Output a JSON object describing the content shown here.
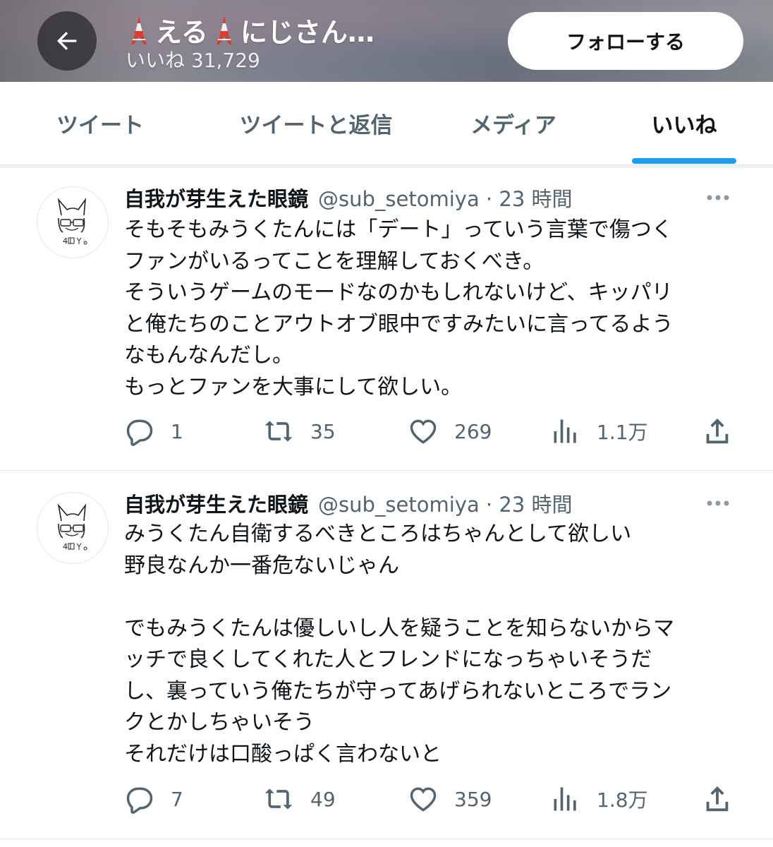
{
  "header": {
    "display_name": "える🗼にじさん…",
    "name_part1": "える",
    "name_part2": "にじさん…",
    "likes_label": "いいね 31,729",
    "follow_label": "フォローする"
  },
  "tabs": [
    {
      "label": "ツイート",
      "active": false
    },
    {
      "label": "ツイートと返信",
      "active": false
    },
    {
      "label": "メディア",
      "active": false
    },
    {
      "label": "いいね",
      "active": true
    }
  ],
  "colors": {
    "accent": "#1d9bf0",
    "text_primary": "#0f1419",
    "text_secondary": "#536471"
  },
  "tweets": [
    {
      "author": "自我が芽生えた眼鏡",
      "handle_time": "@sub_setomiya · 23 時間",
      "lines": [
        "そもそもみうくたんには「デート」っていう言葉で傷つく",
        "ファンがいるってことを理解しておくべき。",
        "そういうゲームのモードなのかもしれないけど、キッパリ",
        "と俺たちのことアウトオブ眼中ですみたいに言ってるよう",
        "なもんなんだし。",
        "もっとファンを大事にして欲しい。"
      ],
      "replies": "1",
      "retweets": "35",
      "likes": "269",
      "views": "1.1万"
    },
    {
      "author": "自我が芽生えた眼鏡",
      "handle_time": "@sub_setomiya · 23 時間",
      "lines": [
        "みうくたん自衛するべきところはちゃんとして欲しい",
        "野良なんか一番危ないじゃん",
        "",
        "でもみうくたんは優しいし人を疑うことを知らないからマ",
        "ッチで良くしてくれた人とフレンドになっちゃいそうだ",
        "し、裏っていう俺たちが守ってあげられないところでラン",
        "クとかしちゃいそう",
        "それだけは口酸っぱく言わないと"
      ],
      "replies": "7",
      "retweets": "49",
      "likes": "359",
      "views": "1.8万"
    }
  ],
  "icons": {
    "back": "arrow-left-icon",
    "more": "more-horizontal-icon",
    "reply": "reply-bubble-icon",
    "retweet": "retweet-icon",
    "like": "heart-icon",
    "views": "bar-chart-icon",
    "share": "share-upload-icon",
    "tower": "tokyo-tower-emoji-icon"
  }
}
